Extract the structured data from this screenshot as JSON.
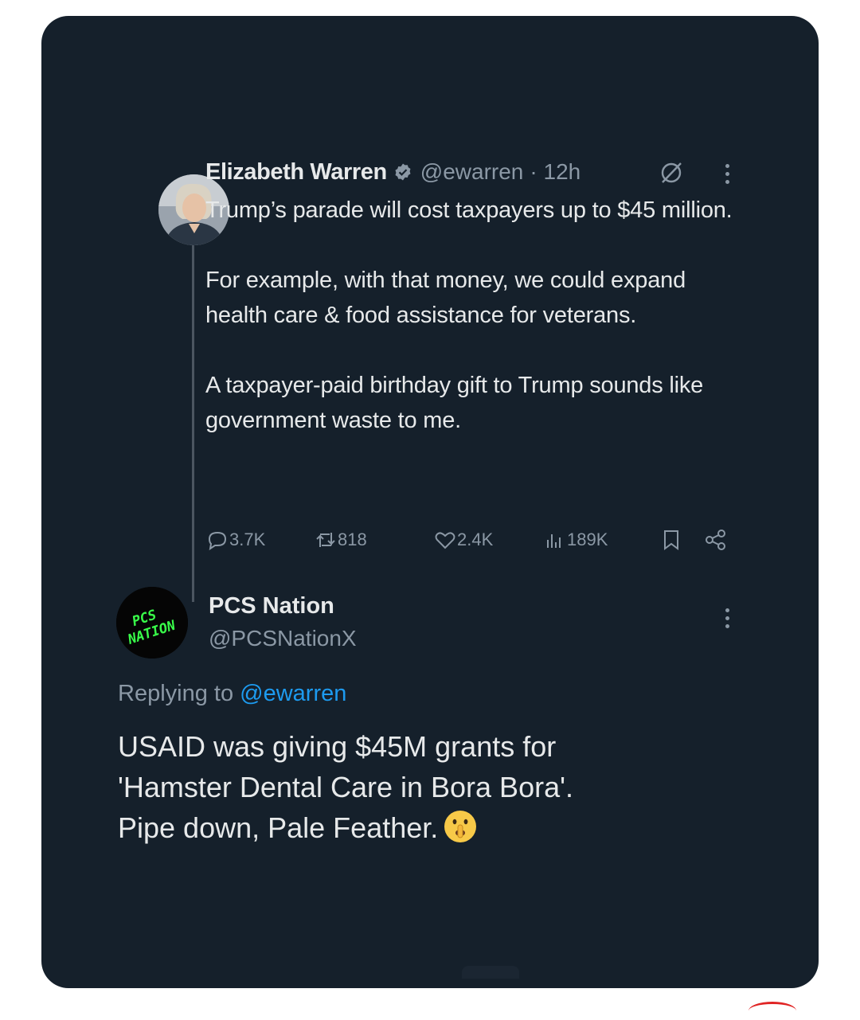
{
  "tweet": {
    "author_name": "Elizabeth Warren",
    "author_handle": "@ewarren",
    "time": "· 12h",
    "paragraphs": [
      "Trump’s parade will cost taxpayers up to $45 million.",
      "For example, with that money, we could expand health care & food assistance for veterans.",
      "A taxpayer-paid birthday gift to Trump sounds like government waste to me."
    ],
    "stats": {
      "replies": "3.7K",
      "reposts": "818",
      "likes": "2.4K",
      "views": "189K"
    }
  },
  "reply": {
    "author_name": "PCS Nation",
    "author_handle": "@PCSNationX",
    "avatar_text": "PCS NATION",
    "replying_to_label": "Replying to",
    "replying_to_handle": "@ewarren",
    "lines": [
      "USAID was giving $45M grants for",
      "'Hamster Dental Care in Bora Bora'.",
      "Pipe down, Pale Feather."
    ],
    "emoji": "shushing-face-emoji"
  },
  "colors": {
    "background": "#15202b",
    "text": "#e7e9ea",
    "muted": "#8b98a5",
    "link": "#1d9bf0",
    "avatar_text": "#39ff4a"
  }
}
